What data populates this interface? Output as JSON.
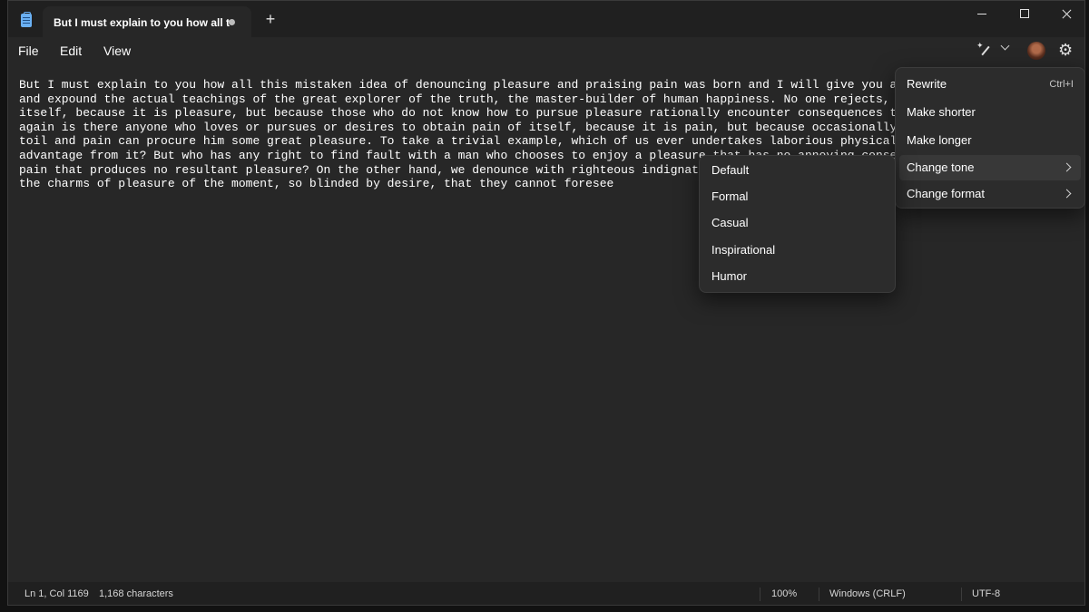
{
  "tab": {
    "title": "But I must explain to you how all t"
  },
  "menubar": {
    "file": "File",
    "edit": "Edit",
    "view": "View"
  },
  "editor": {
    "lines": [
      "But I must explain to you how all this mistaken idea of denouncing pleasure and praising pain was born and I will give you a comp",
      "and expound the actual teachings of the great explorer of the truth, the master-builder of human happiness. No one rejects, disli",
      "itself, because it is pleasure, but because those who do not know how to pursue pleasure rationally encounter consequences that a",
      "again is there anyone who loves or pursues or desires to obtain pain of itself, because it is pain, but because occasionally circ",
      "toil and pain can procure him some great pleasure. To take a trivial example, which of us ever undertakes laborious physical exer",
      "advantage from it? But who has any right to find fault with a man who chooses to enjoy a pleasure that has no annoying consequenc",
      "pain that produces no resultant pleasure? On the other hand, we denounce with righteous indignation",
      "the charms of pleasure of the moment, so blinded by desire, that they cannot foresee"
    ]
  },
  "rewrite_menu": {
    "items": [
      {
        "label": "Rewrite",
        "shortcut": "Ctrl+I"
      },
      {
        "label": "Make shorter"
      },
      {
        "label": "Make longer"
      },
      {
        "label": "Change tone",
        "active": true
      },
      {
        "label": "Change format"
      }
    ]
  },
  "tone_menu": {
    "items": [
      {
        "label": "Default"
      },
      {
        "label": "Formal"
      },
      {
        "label": "Casual"
      },
      {
        "label": "Inspirational"
      },
      {
        "label": "Humor"
      }
    ]
  },
  "statusbar": {
    "position": "Ln 1, Col 1169",
    "characters": "1,168 characters",
    "zoom": "100%",
    "line_ending": "Windows (CRLF)",
    "encoding": "UTF-8"
  },
  "icons": {
    "app": "notepad-icon",
    "copilot": "rewrite-pen-icon",
    "settings": "gear-icon"
  },
  "colors": {
    "background": "#272727",
    "titlebar": "#202020",
    "menu_bg": "#2c2c2c",
    "text": "#ffffff"
  }
}
